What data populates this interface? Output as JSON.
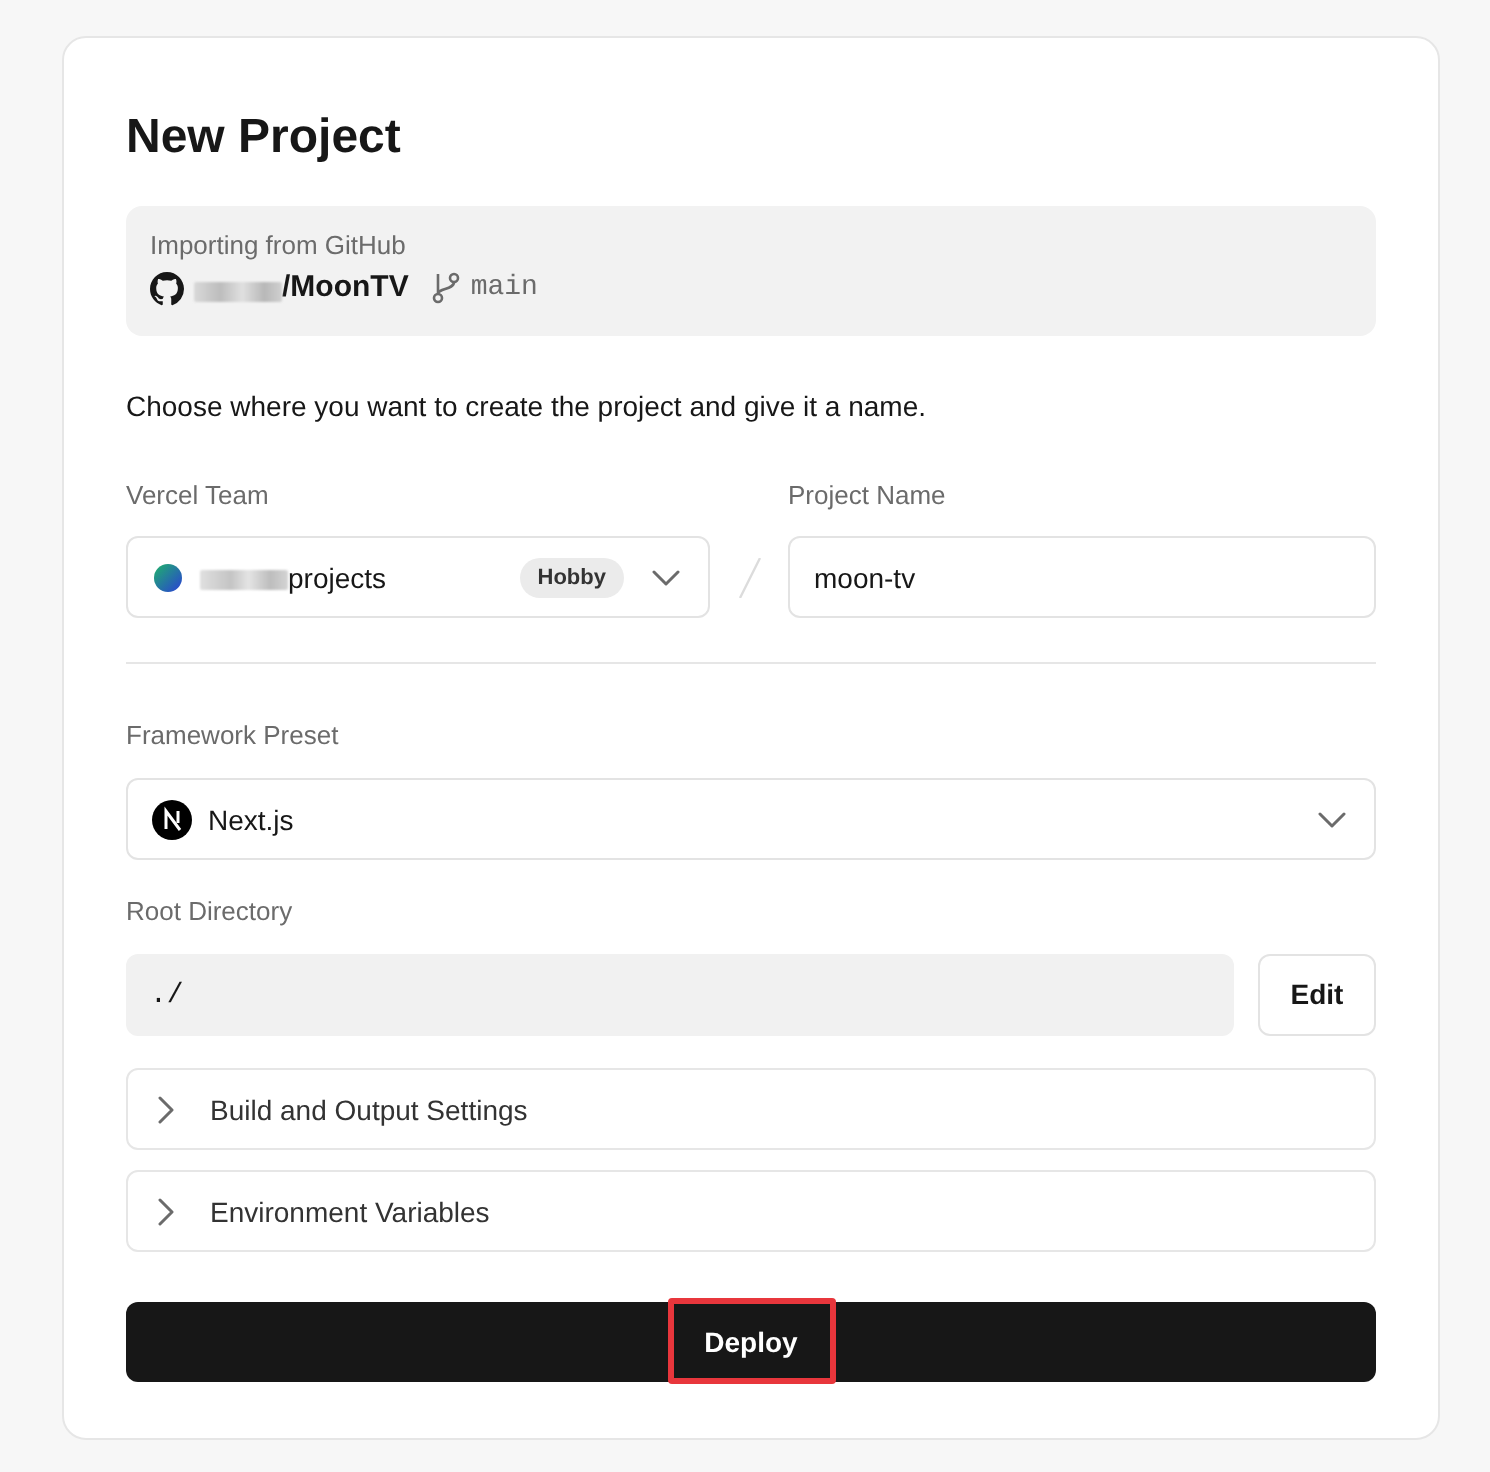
{
  "page": {
    "title": "New Project"
  },
  "import_source": {
    "label": "Importing from GitHub",
    "repository": "/MoonTV",
    "branch": "main"
  },
  "intro": "Choose where you want to create the project and give it a name.",
  "team": {
    "label": "Vercel Team",
    "value": "projects",
    "badge": "Hobby"
  },
  "project_name": {
    "label": "Project Name",
    "value": "moon-tv"
  },
  "framework": {
    "label": "Framework Preset",
    "value": "Next.js"
  },
  "root_directory": {
    "label": "Root Directory",
    "value": "./",
    "button": "Edit"
  },
  "sections": [
    {
      "label": "Build and Output Settings",
      "expanded": false
    },
    {
      "label": "Environment Variables",
      "expanded": false
    }
  ],
  "deploy": {
    "label": "Deploy",
    "highlighted": true
  }
}
